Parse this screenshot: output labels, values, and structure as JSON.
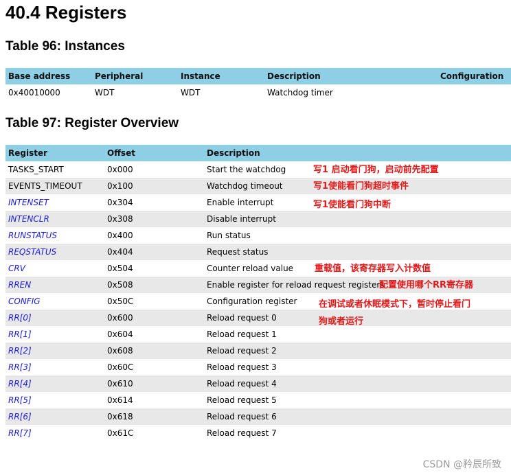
{
  "section_title": "40.4 Registers",
  "instances": {
    "caption": "Table 96: Instances",
    "headers": [
      "Base address",
      "Peripheral",
      "Instance",
      "Description",
      "Configuration"
    ],
    "rows": [
      [
        "0x40010000",
        "WDT",
        "WDT",
        "Watchdog timer",
        ""
      ]
    ]
  },
  "overview": {
    "caption": "Table 97: Register Overview",
    "headers": [
      "Register",
      "Offset",
      "Description"
    ],
    "rows": [
      {
        "name": "TASKS_START",
        "link": false,
        "offset": "0x000",
        "desc": "Start the watchdog"
      },
      {
        "name": "EVENTS_TIMEOUT",
        "link": false,
        "offset": "0x100",
        "desc": "Watchdog timeout"
      },
      {
        "name": "INTENSET",
        "link": true,
        "offset": "0x304",
        "desc": "Enable interrupt"
      },
      {
        "name": "INTENCLR",
        "link": true,
        "offset": "0x308",
        "desc": "Disable interrupt"
      },
      {
        "name": "RUNSTATUS",
        "link": true,
        "offset": "0x400",
        "desc": "Run status"
      },
      {
        "name": "REQSTATUS",
        "link": true,
        "offset": "0x404",
        "desc": "Request status"
      },
      {
        "name": "CRV",
        "link": true,
        "offset": "0x504",
        "desc": "Counter reload value"
      },
      {
        "name": "RREN",
        "link": true,
        "offset": "0x508",
        "desc": "Enable register for reload request registers"
      },
      {
        "name": "CONFIG",
        "link": true,
        "offset": "0x50C",
        "desc": "Configuration register"
      },
      {
        "name": "RR[0]",
        "link": true,
        "offset": "0x600",
        "desc": "Reload request 0"
      },
      {
        "name": "RR[1]",
        "link": true,
        "offset": "0x604",
        "desc": "Reload request 1"
      },
      {
        "name": "RR[2]",
        "link": true,
        "offset": "0x608",
        "desc": "Reload request 2"
      },
      {
        "name": "RR[3]",
        "link": true,
        "offset": "0x60C",
        "desc": "Reload request 3"
      },
      {
        "name": "RR[4]",
        "link": true,
        "offset": "0x610",
        "desc": "Reload request 4"
      },
      {
        "name": "RR[5]",
        "link": true,
        "offset": "0x614",
        "desc": "Reload request 5"
      },
      {
        "name": "RR[6]",
        "link": true,
        "offset": "0x618",
        "desc": "Reload request 6"
      },
      {
        "name": "RR[7]",
        "link": true,
        "offset": "0x61C",
        "desc": "Reload request 7"
      }
    ]
  },
  "annotations": [
    "写1 启动看门狗，启动前先配置",
    "写1使能看门狗超时事件",
    "写1使能看门狗中断",
    "重载值，该寄存器写入计数值",
    "配置使用哪个RR寄存器",
    "在调试或者休眠模式下，暂时停止看门",
    "狗或者运行"
  ],
  "watermark": "CSDN @矜辰所致",
  "colors": {
    "header_bg": "#8ecfe6",
    "row_alt": "#e8e8e8",
    "link": "#1a1adc",
    "annotation": "#e01a1a"
  }
}
